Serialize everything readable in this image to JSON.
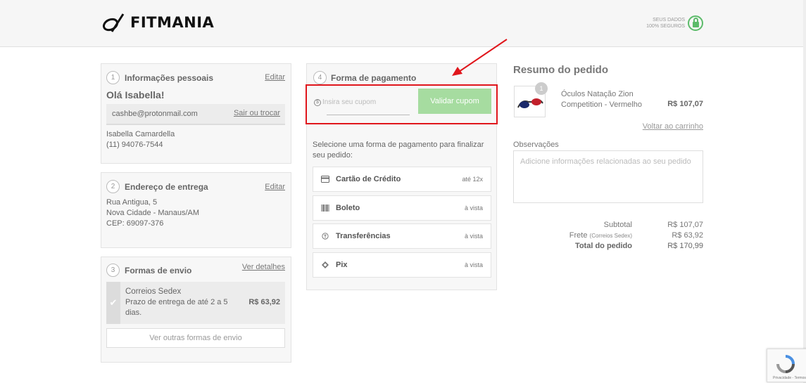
{
  "header": {
    "logo_text": "FITMANIA",
    "secure_line1": "SEUS DADOS",
    "secure_line2": "100% SEGUROS"
  },
  "personal": {
    "step": "1",
    "title": "Informações pessoais",
    "edit": "Editar",
    "greeting": "Olá Isabella!",
    "email": "cashbe@protonmail.com",
    "switch": "Sair ou trocar",
    "name": "Isabella Camardella",
    "phone": "(11) 94076-7544"
  },
  "address": {
    "step": "2",
    "title": "Endereço de entrega",
    "edit": "Editar",
    "line1": "Rua Antigua, 5",
    "line2": "Nova Cidade - Manaus/AM",
    "line3": "CEP: 69097-376"
  },
  "shipping": {
    "step": "3",
    "title": "Formas de envio",
    "details": "Ver detalhes",
    "option_name": "Correios Sedex",
    "option_desc": "Prazo de entrega de até 2 a 5 dias.",
    "option_price": "R$ 63,92",
    "other_button": "Ver outras formas de envio"
  },
  "payment": {
    "step": "4",
    "title": "Forma de pagamento",
    "coupon_placeholder": "Insira seu cupom",
    "coupon_button": "Validar cupom",
    "instructions": "Selecione uma forma de pagamento para finalizar seu pedido:",
    "options": [
      {
        "label": "Cartão de Crédito",
        "note": "até 12x",
        "icon": "credit-card-icon"
      },
      {
        "label": "Boleto",
        "note": "à vista",
        "icon": "barcode-icon"
      },
      {
        "label": "Transferências",
        "note": "à vista",
        "icon": "transfer-icon"
      },
      {
        "label": "Pix",
        "note": "à vista",
        "icon": "pix-icon"
      }
    ]
  },
  "summary": {
    "title": "Resumo do pedido",
    "qty": "1",
    "product_name": "Óculos Natação Zion Competition - Vermelho",
    "product_price": "R$ 107,07",
    "back_link": "Voltar ao carrinho",
    "obs_label": "Observações",
    "obs_placeholder": "Adicione informações relacionadas ao seu pedido",
    "subtotal_label": "Subtotal",
    "subtotal_value": "R$ 107,07",
    "shipping_label": "Frete",
    "shipping_sub": "(Correios Sedex)",
    "shipping_value": "R$ 63,92",
    "total_label": "Total do pedido",
    "total_value": "R$ 170,99"
  },
  "recaptcha": {
    "text": "Privacidade - Termos"
  },
  "colors": {
    "highlight": "#e0161c",
    "coupon_button": "#a6dca0",
    "secure": "#5cbb6a"
  }
}
